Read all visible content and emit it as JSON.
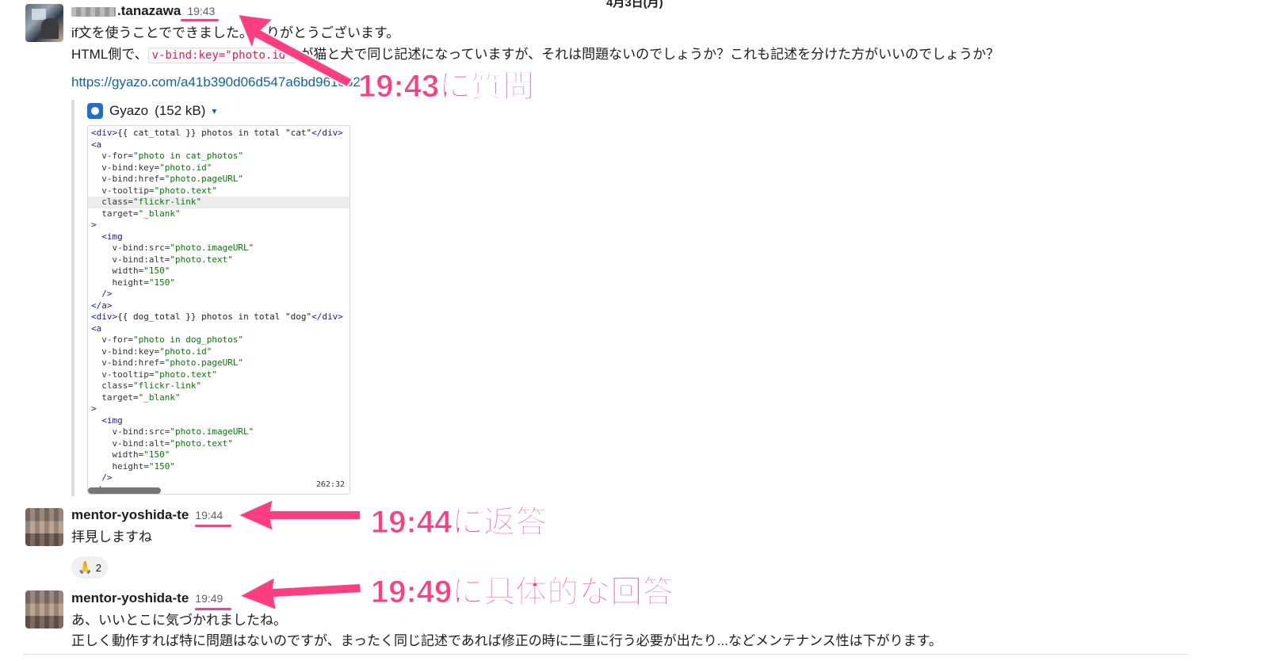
{
  "date_divider": "4月3日(月)",
  "messages": [
    {
      "username_suffix": ".tanazawa",
      "time": "19:43",
      "line1": "if文を使うことでできました。ありがとうございます。",
      "line2_pre": "HTML側で、",
      "line2_code": "v-bind:key=\"photo.id\"",
      "line2_post": " が猫と犬で同じ記述になっていますが、それは問題ないのでしょうか？これも記述を分けた方がいいのでしょうか？",
      "link": "https://gyazo.com/a41b390d06d547a6bd961852"
    },
    {
      "username": "mentor-yoshida-te",
      "time": "19:44",
      "line1": "拝見しますね"
    },
    {
      "username": "mentor-yoshida-te",
      "time": "19:49",
      "line1": "あ、いいとこに気づかれましたね。",
      "line2": "正しく動作すれば特に問題はないのですが、まったく同じ記述であれば修正の時に二重に行う必要が出たり...などメンテナンス性は下がります。"
    }
  ],
  "attachment": {
    "source": "Gyazo",
    "size": "(152 kB)",
    "icon": "gyazo-icon",
    "caret": "▾",
    "position": "262:32",
    "code": [
      [
        [
          "tag",
          "<div>"
        ],
        [
          "plain",
          "{{ cat_total }} photos in total \"cat\""
        ],
        [
          "tag",
          "</div>"
        ]
      ],
      [
        [
          "tag",
          "<a"
        ]
      ],
      [
        [
          "attr",
          "  v-for="
        ],
        [
          "str",
          "\"photo in cat_photos\""
        ]
      ],
      [
        [
          "attr",
          "  v-bind:key="
        ],
        [
          "str",
          "\"photo.id\""
        ]
      ],
      [
        [
          "attr",
          "  v-bind:href="
        ],
        [
          "str",
          "\"photo.pageURL\""
        ]
      ],
      [
        [
          "attr",
          "  v-tooltip="
        ],
        [
          "str",
          "\"photo.text\""
        ]
      ],
      [
        [
          "attr",
          "  class="
        ],
        [
          "str",
          "\"flickr-link\""
        ]
      ],
      [
        [
          "attr",
          "  target="
        ],
        [
          "str",
          "\"_blank\""
        ]
      ],
      [
        [
          "tag",
          ">"
        ]
      ],
      [
        [
          "tag",
          "  <img"
        ]
      ],
      [
        [
          "attr",
          "    v-bind:src="
        ],
        [
          "str",
          "\"photo.imageURL\""
        ]
      ],
      [
        [
          "attr",
          "    v-bind:alt="
        ],
        [
          "str",
          "\"photo.text\""
        ]
      ],
      [
        [
          "attr",
          "    width="
        ],
        [
          "str",
          "\"150\""
        ]
      ],
      [
        [
          "attr",
          "    height="
        ],
        [
          "str",
          "\"150\""
        ]
      ],
      [
        [
          "tag",
          "  />"
        ]
      ],
      [
        [
          "tag",
          "</a>"
        ]
      ],
      [
        [
          "tag",
          "<div>"
        ],
        [
          "plain",
          "{{ dog_total }} photos in total \"dog\""
        ],
        [
          "tag",
          "</div>"
        ]
      ],
      [
        [
          "tag",
          "<a"
        ]
      ],
      [
        [
          "attr",
          "  v-for="
        ],
        [
          "str",
          "\"photo in dog_photos\""
        ]
      ],
      [
        [
          "attr",
          "  v-bind:key="
        ],
        [
          "str",
          "\"photo.id\""
        ]
      ],
      [
        [
          "attr",
          "  v-bind:href="
        ],
        [
          "str",
          "\"photo.pageURL\""
        ]
      ],
      [
        [
          "attr",
          "  v-tooltip="
        ],
        [
          "str",
          "\"photo.text\""
        ]
      ],
      [
        [
          "attr",
          "  class="
        ],
        [
          "str",
          "\"flickr-link\""
        ]
      ],
      [
        [
          "attr",
          "  target="
        ],
        [
          "str",
          "\"_blank\""
        ]
      ],
      [
        [
          "tag",
          ">"
        ]
      ],
      [
        [
          "tag",
          "  <img"
        ]
      ],
      [
        [
          "attr",
          "    v-bind:src="
        ],
        [
          "str",
          "\"photo.imageURL\""
        ]
      ],
      [
        [
          "attr",
          "    v-bind:alt="
        ],
        [
          "str",
          "\"photo.text\""
        ]
      ],
      [
        [
          "attr",
          "    width="
        ],
        [
          "str",
          "\"150\""
        ]
      ],
      [
        [
          "attr",
          "    height="
        ],
        [
          "str",
          "\"150\""
        ]
      ],
      [
        [
          "tag",
          "  />"
        ]
      ],
      [
        [
          "tag",
          "</a>"
        ]
      ]
    ]
  },
  "reaction": {
    "emoji": "🙏",
    "count": "2"
  },
  "annotations": {
    "a1": "19:43に質問",
    "a2": "19:44に返答",
    "a3": "19:49に具体的な回答"
  },
  "colors": {
    "annotation": "#ff3d7f",
    "link": "#1264a3",
    "code_inline": "#e01e5a"
  }
}
